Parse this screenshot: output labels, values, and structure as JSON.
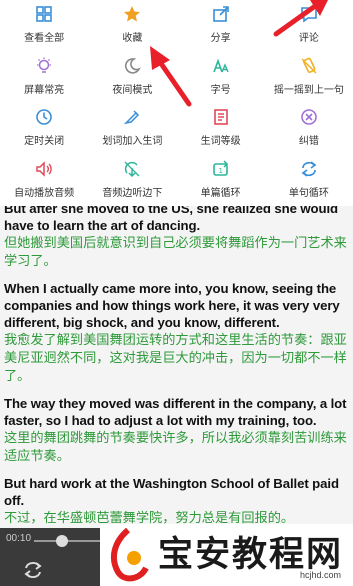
{
  "menu": {
    "items": [
      {
        "label": "查看全部",
        "icon": "grid-icon",
        "color": "#3a8fd9"
      },
      {
        "label": "收藏",
        "icon": "star-icon",
        "color": "#f0a020"
      },
      {
        "label": "分享",
        "icon": "share-icon",
        "color": "#3a8fd9"
      },
      {
        "label": "评论",
        "icon": "comment-icon",
        "color": "#3a8fd9"
      },
      {
        "label": "屏幕常亮",
        "icon": "bulb-icon",
        "color": "#a070d8"
      },
      {
        "label": "夜间模式",
        "icon": "moon-icon",
        "color": "#888888"
      },
      {
        "label": "字号",
        "icon": "font-size-icon",
        "color": "#2bb59a"
      },
      {
        "label": "摇一摇到上一句",
        "icon": "shake-icon",
        "color": "#f0b020"
      },
      {
        "label": "定时关闭",
        "icon": "clock-icon",
        "color": "#3a8fd9"
      },
      {
        "label": "划词加入生词",
        "icon": "add-word-icon",
        "color": "#3a8fd9"
      },
      {
        "label": "生词等级",
        "icon": "word-level-icon",
        "color": "#e04a5a"
      },
      {
        "label": "纠错",
        "icon": "error-icon",
        "color": "#a070d8"
      },
      {
        "label": "自动播放音频",
        "icon": "speaker-icon",
        "color": "#e04a5a"
      },
      {
        "label": "音频边听边下",
        "icon": "download-audio-icon",
        "color": "#2bb59a"
      },
      {
        "label": "单篇循环",
        "icon": "single-loop-icon",
        "color": "#2bb59a"
      },
      {
        "label": "单句循环",
        "icon": "sentence-loop-icon",
        "color": "#3a8fd9"
      }
    ]
  },
  "content": {
    "partial_top": "But after she moved to the US, she realized she would",
    "paragraphs": [
      {
        "en": "have to learn the art of dancing.",
        "zh": "但她搬到美国后就意识到自己必须要将舞蹈作为一门艺术来学习了。"
      },
      {
        "en": "When I actually came more into, you know, seeing the companies and how things work here, it was very very different, big shock, and you know, different.",
        "zh": "我愈发了解到美国舞团运转的方式和这里生活的节奏：跟亚美尼亚迥然不同，这对我是巨大的冲击，因为一切都不一样了。"
      },
      {
        "en": "The way they moved was different in the company, a lot faster, so I had to adjust a lot with my training, too.",
        "zh": "这里的舞团跳舞的节奏要快许多，所以我必须靠刻苦训练来适应节奏。"
      },
      {
        "en": "But hard work at the Washington School of Ballet paid off.",
        "zh": "不过，在华盛顿芭蕾舞学院，努力总是有回报的。"
      }
    ]
  },
  "player": {
    "time": "00:10"
  },
  "watermark": {
    "title": "宝安教程网",
    "url": "hcjhd.com"
  },
  "colors": {
    "english": "#111111",
    "chinese": "#2f9a3b",
    "arrow": "#e8202a"
  }
}
